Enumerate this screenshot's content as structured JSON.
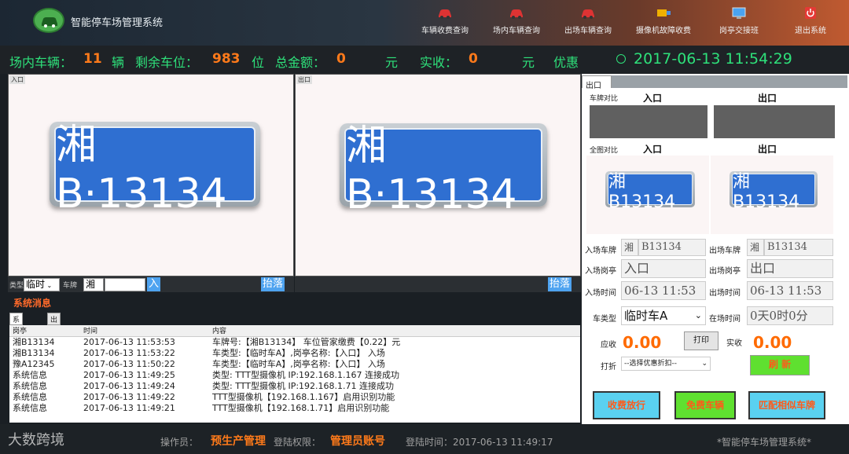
{
  "app": {
    "title": "智能停车场管理系统"
  },
  "toolbar": [
    {
      "label": "车辆收费查询"
    },
    {
      "label": "场内车辆查询"
    },
    {
      "label": "出场车辆查询"
    },
    {
      "label": "摄像机故障收费"
    },
    {
      "label": "岗亭交接班"
    },
    {
      "label": "退出系统"
    }
  ],
  "stats": {
    "in_lot_label": "场内车辆：",
    "in_lot_value": "11",
    "in_lot_unit": "辆",
    "remaining_label": "剩余车位：",
    "remaining_value": "983",
    "remaining_unit": "位",
    "total_label": "总金额：",
    "total_value": "0",
    "total_unit": "元",
    "paid_label": "实收：",
    "paid_value": "0",
    "paid_unit": "元",
    "discount_label": "优惠",
    "datetime": "2017-06-13 11:54:29"
  },
  "camera": {
    "left_tag": "入口",
    "right_tag": "出口",
    "plate_text": "湘B·13134",
    "type_label": "类型",
    "type_value": "临时",
    "plate_label": "车牌",
    "plate_prefix": "湘",
    "in_btn": "入",
    "lift_btn_left": "抬落",
    "lift_btn_right": "抬落"
  },
  "messages": {
    "title": "系统消息",
    "tabs": [
      "系统事件",
      "出场记录"
    ],
    "columns": [
      "岗亭",
      "时间",
      "内容"
    ],
    "rows": [
      [
        "湘B13134",
        "2017-06-13 11:53:53",
        "车牌号:【湘B13134】 车位管家缴费【0.22】元"
      ],
      [
        "湘B13134",
        "2017-06-13 11:53:22",
        "车类型:【临时车A】,岗亭名称:【入口】 入场"
      ],
      [
        "豫A12345",
        "2017-06-13 11:50:22",
        "车类型:【临时车A】,岗亭名称:【入口】 入场"
      ],
      [
        "系统信息",
        "2017-06-13 11:49:25",
        "类型: TTT型摄像机 IP:192.168.1.167 连接成功"
      ],
      [
        "系统信息",
        "2017-06-13 11:49:24",
        "类型: TTT型摄像机 IP:192.168.1.71 连接成功"
      ],
      [
        "系统信息",
        "2017-06-13 11:49:22",
        "TTT型摄像机【192.168.1.167】启用识别功能"
      ],
      [
        "系统信息",
        "2017-06-13 11:49:21",
        "TTT型摄像机【192.168.1.71】启用识别功能"
      ]
    ]
  },
  "right": {
    "tab": "出口",
    "plate_compare": "车牌对比",
    "entry": "入口",
    "exit": "出口",
    "full_compare": "全图对比",
    "plate_small": "湘B13134",
    "in_plate_label": "入场车牌",
    "in_plate_prefix": "湘",
    "in_plate_value": "B13134",
    "out_plate_label": "出场车牌",
    "out_plate_prefix": "湘",
    "out_plate_value": "B13134",
    "in_booth_label": "入场岗亭",
    "in_booth_value": "入口",
    "out_booth_label": "出场岗亭",
    "out_booth_value": "出口",
    "in_time_label": "入场时间",
    "in_time_value": "06-13 11:53",
    "out_time_label": "出场时间",
    "out_time_value": "06-13 11:53",
    "car_type_label": "车类型",
    "car_type_value": "临时车A",
    "stay_label": "在场时间",
    "stay_value": "0天0时0分",
    "due_label": "应收",
    "due_value": "0.00",
    "print_label": "打印",
    "paid_label": "实收",
    "paid_value": "0.00",
    "discount_label": "打折",
    "discount_value": "--选择优惠折扣--",
    "refresh_label": "刷 新",
    "btn_charge": "收费放行",
    "btn_free": "免费车辆",
    "btn_match": "匹配相似车牌"
  },
  "status": {
    "operator_label": "操作员：",
    "operator_value": "预生产管理",
    "perm_label": "登陆权限：",
    "perm_value": "管理员账号",
    "login_label": "登陆时间：2017-06-13 11:49:17",
    "app_name": "*智能停车场管理系统*"
  },
  "watermark": "大数跨境",
  "colors": {
    "green": "#2ee07a",
    "orange": "#ff7a1a",
    "plate_blue": "#2f6fd1"
  }
}
